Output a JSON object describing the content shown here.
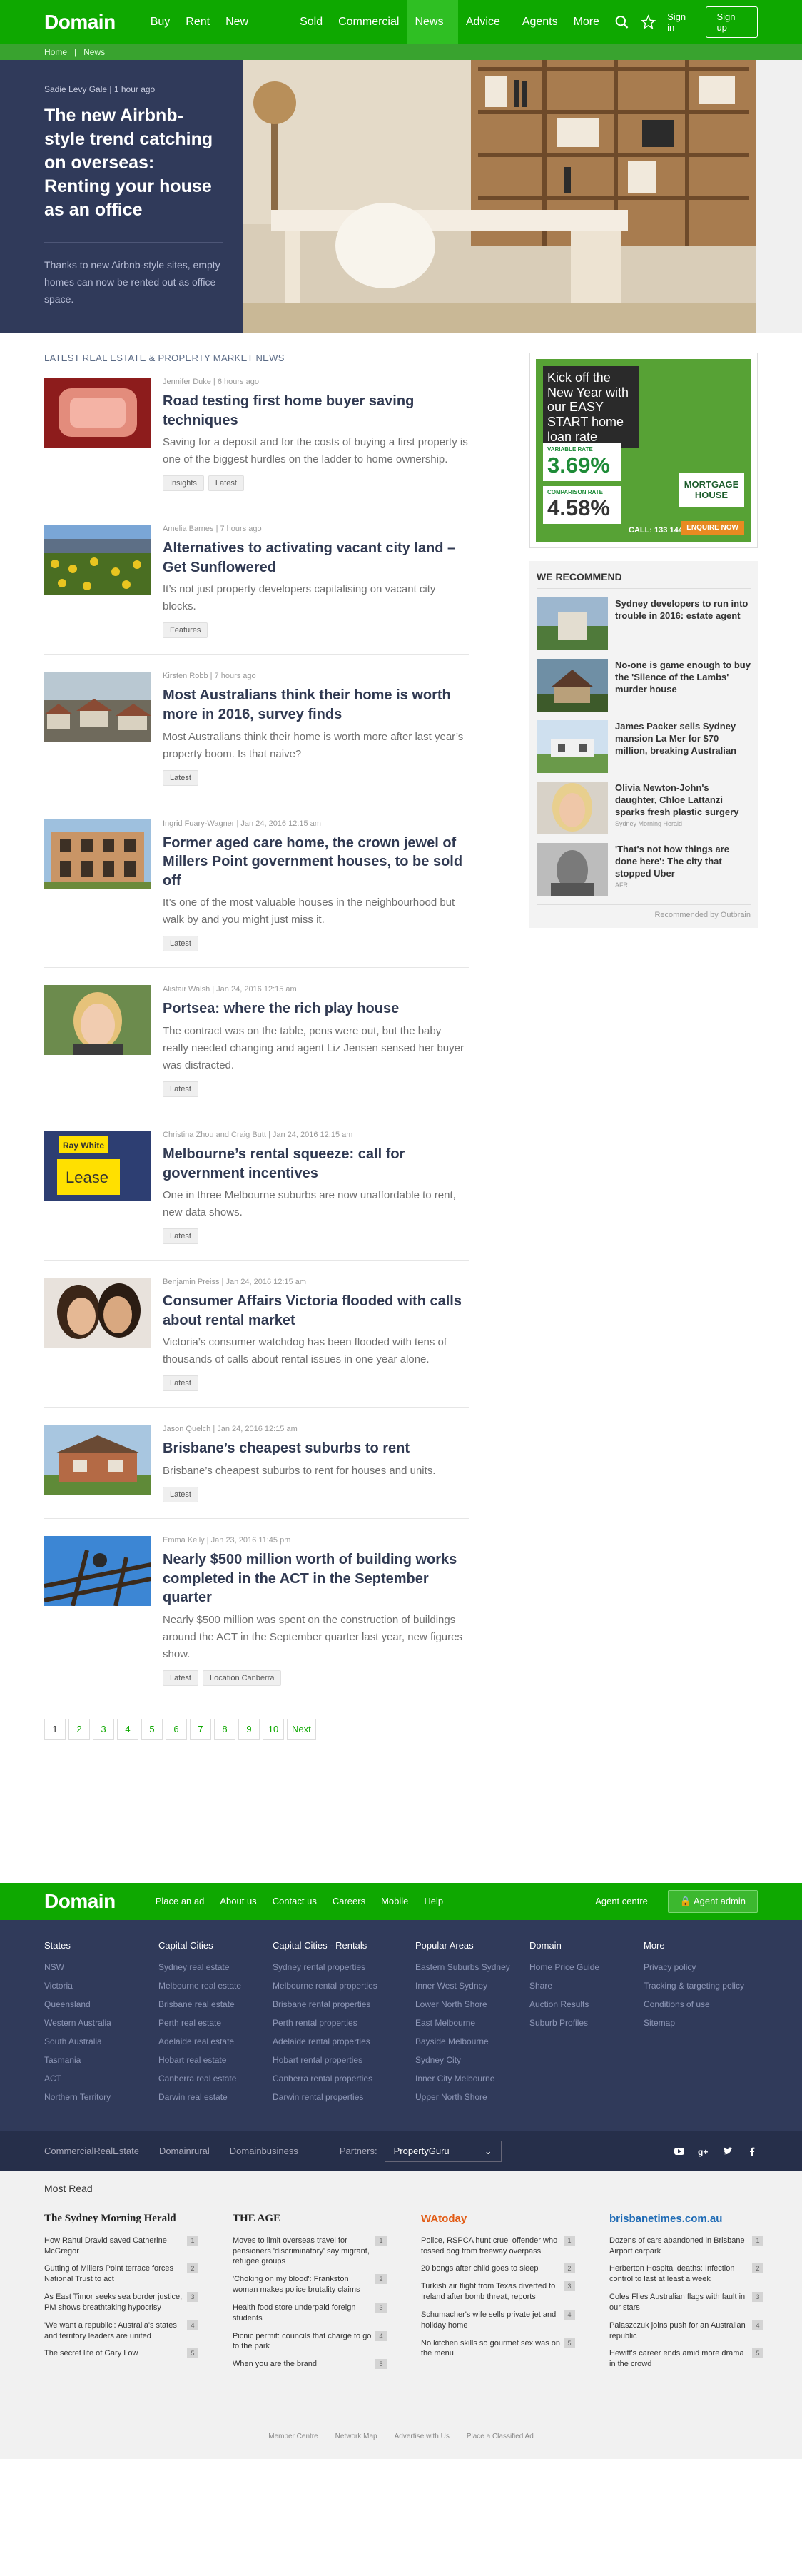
{
  "nav": {
    "logo": "Domain",
    "links": [
      "Buy",
      "Rent",
      "New Homes",
      "Sold",
      "Commercial",
      "News ▾",
      "Advice ▾",
      "Agents",
      "More ▾"
    ],
    "signin": "Sign in",
    "signup": "Sign up"
  },
  "breadcrumb": [
    "Home",
    "News"
  ],
  "hero": {
    "meta": "Sadie Levy Gale | 1 hour ago",
    "title": "The new Airbnb-style trend catching on overseas: Renting your house as an office",
    "summary": "Thanks to new Airbnb-style sites, empty homes can now be rented out as office space."
  },
  "section_title": "LATEST REAL ESTATE & PROPERTY MARKET NEWS",
  "articles": [
    {
      "meta": "Jennifer Duke | 6 hours ago",
      "title": "Road testing first home buyer saving techniques",
      "summary": "Saving for a deposit and for the costs of buying a first property is one of the biggest hurdles on the ladder to home ownership.",
      "tags": [
        "Insights",
        "Latest"
      ]
    },
    {
      "meta": "Amelia Barnes | 7 hours ago",
      "title": "Alternatives to activating vacant city land – Get Sunflowered",
      "summary": "It’s not just property developers capitalising on vacant city blocks.",
      "tags": [
        "Features"
      ]
    },
    {
      "meta": "Kirsten Robb | 7 hours ago",
      "title": "Most Australians think their home is worth more in 2016, survey finds",
      "summary": "Most Australians think their home is worth more after last year’s property boom. Is that naive?",
      "tags": [
        "Latest"
      ]
    },
    {
      "meta": "Ingrid Fuary-Wagner | Jan 24, 2016 12:15 am",
      "title": "Former aged care home, the crown jewel of Millers Point government houses, to be sold off",
      "summary": "It’s one of the most valuable houses in the neighbourhood but walk by and you might just miss it.",
      "tags": [
        "Latest"
      ]
    },
    {
      "meta": "Alistair Walsh | Jan 24, 2016 12:15 am",
      "title": "Portsea: where the rich play house",
      "summary": "The contract was on the table, pens were out, but the baby really needed changing and agent Liz Jensen sensed her buyer was distracted.",
      "tags": [
        "Latest"
      ]
    },
    {
      "meta": "Christina Zhou and Craig Butt | Jan 24, 2016 12:15 am",
      "title": "Melbourne’s rental squeeze: call for government incentives",
      "summary": "One in three Melbourne suburbs are now unaffordable to rent, new data shows.",
      "tags": [
        "Latest"
      ]
    },
    {
      "meta": "Benjamin Preiss | Jan 24, 2016 12:15 am",
      "title": "Consumer Affairs Victoria flooded with calls about rental market",
      "summary": "Victoria’s consumer watchdog has been flooded with tens of thousands of calls about rental issues in one year alone.",
      "tags": [
        "Latest"
      ]
    },
    {
      "meta": "Jason Quelch | Jan 24, 2016 12:15 am",
      "title": "Brisbane’s cheapest suburbs to rent",
      "summary": "Brisbane’s cheapest suburbs to rent for houses and units.",
      "tags": [
        "Latest"
      ]
    },
    {
      "meta": "Emma Kelly | Jan 23, 2016 11:45 pm",
      "title": "Nearly $500 million worth of building works completed in the ACT in the September quarter",
      "summary": "Nearly $500 million was spent on the construction of buildings around the ACT in the September quarter last year, new figures show.",
      "tags": [
        "Latest",
        "Location Canberra"
      ]
    }
  ],
  "pagination": [
    "1",
    "2",
    "3",
    "4",
    "5",
    "6",
    "7",
    "8",
    "9",
    "10",
    "Next"
  ],
  "ad": {
    "headline": "Kick off the New Year with our EASY START home loan rate",
    "variable_label": "VARIABLE RATE",
    "variable_rate": "3.69%",
    "comparison_label": "COMPARISON RATE",
    "comparison_rate": "4.58%",
    "brand": "MORTGAGE HOUSE",
    "call": "CALL: 133 144",
    "enquire": "ENQUIRE NOW"
  },
  "recommend": {
    "title": "WE RECOMMEND",
    "items": [
      {
        "title": "Sydney developers to run into trouble in 2016: estate agent",
        "source": ""
      },
      {
        "title": "No-one is game enough to buy the 'Silence of the Lambs' murder house",
        "source": ""
      },
      {
        "title": "James Packer sells Sydney mansion La Mer for $70 million, breaking Australian",
        "source": ""
      },
      {
        "title": "Olivia Newton-John's daughter, Chloe Lattanzi sparks fresh plastic surgery",
        "source": "Sydney Morning Herald"
      },
      {
        "title": "'That's not how things are done here': The city that stopped Uber",
        "source": "AFR"
      }
    ],
    "footer": "Recommended by Outbrain"
  },
  "footer": {
    "logo": "Domain",
    "links": [
      "Place an ad",
      "About us",
      "Contact us",
      "Careers",
      "Mobile",
      "Help"
    ],
    "agent_centre": "Agent centre",
    "agent_admin": "Agent admin"
  },
  "directory": [
    {
      "title": "States",
      "items": [
        "NSW",
        "Victoria",
        "Queensland",
        "Western Australia",
        "South Australia",
        "Tasmania",
        "ACT",
        "Northern Territory"
      ]
    },
    {
      "title": "Capital Cities",
      "items": [
        "Sydney real estate",
        "Melbourne real estate",
        "Brisbane real estate",
        "Perth real estate",
        "Adelaide real estate",
        "Hobart real estate",
        "Canberra real estate",
        "Darwin real estate"
      ]
    },
    {
      "title": "Capital Cities - Rentals",
      "items": [
        "Sydney rental properties",
        "Melbourne rental properties",
        "Brisbane rental properties",
        "Perth rental properties",
        "Adelaide rental properties",
        "Hobart rental properties",
        "Canberra rental properties",
        "Darwin rental properties"
      ]
    },
    {
      "title": "Popular Areas",
      "items": [
        "Eastern Suburbs Sydney",
        "Inner West Sydney",
        "Lower North Shore",
        "East Melbourne",
        "Bayside Melbourne",
        "Sydney City",
        "Inner City Melbourne",
        "Upper North Shore"
      ]
    },
    {
      "title": "Domain",
      "items": [
        "Home Price Guide",
        "Share",
        "Auction Results",
        "Suburb Profiles"
      ]
    },
    {
      "title": "More",
      "items": [
        "Privacy policy",
        "Tracking & targeting policy",
        "Conditions of use",
        "Sitemap"
      ]
    }
  ],
  "brands": [
    "CommercialRealEstate",
    "Domainrural",
    "Domainbusiness"
  ],
  "partners_label": "Partners:",
  "partner_selected": "PropertyGuru",
  "mostread": {
    "title": "Most Read",
    "columns": [
      {
        "logo": "The Sydney Morning Herald",
        "items": [
          {
            "t": "How Rahul Dravid saved Catherine McGregor",
            "n": "1"
          },
          {
            "t": "Gutting of Millers Point terrace forces National Trust to act",
            "n": "2"
          },
          {
            "t": "As East Timor seeks sea border justice, PM shows breathtaking hypocrisy",
            "n": "3"
          },
          {
            "t": "'We want a republic': Australia's states and territory leaders are united",
            "n": "4"
          },
          {
            "t": "The secret life of Gary Low",
            "n": "5"
          }
        ]
      },
      {
        "logo": "THE AGE",
        "items": [
          {
            "t": "Moves to limit overseas travel for pensioners 'discriminatory' say migrant, refugee groups",
            "n": "1"
          },
          {
            "t": "'Choking on my blood': Frankston woman makes police brutality claims",
            "n": "2"
          },
          {
            "t": "Health food store underpaid foreign students",
            "n": "3"
          },
          {
            "t": "Picnic permit: councils that charge to go to the park",
            "n": "4"
          },
          {
            "t": "When you are the brand",
            "n": "5"
          }
        ]
      },
      {
        "logo": "WAtoday",
        "items": [
          {
            "t": "Police, RSPCA hunt cruel offender who tossed dog from freeway overpass",
            "n": "1"
          },
          {
            "t": "20 bongs after child goes to sleep",
            "n": "2"
          },
          {
            "t": "Turkish air flight from Texas diverted to Ireland after bomb threat, reports",
            "n": "3"
          },
          {
            "t": "Schumacher's wife sells private jet and holiday home",
            "n": "4"
          },
          {
            "t": "No kitchen skills so gourmet sex was on the menu",
            "n": "5"
          }
        ]
      },
      {
        "logo": "brisbanetimes.com.au",
        "items": [
          {
            "t": "Dozens of cars abandoned in Brisbane Airport carpark",
            "n": "1"
          },
          {
            "t": "Herberton Hospital deaths: Infection control to last at least a week",
            "n": "2"
          },
          {
            "t": "Coles Flies Australian flags with fault in our stars",
            "n": "3"
          },
          {
            "t": "Palaszczuk joins push for an Australian republic",
            "n": "4"
          },
          {
            "t": "Hewitt's career ends amid more drama in the crowd",
            "n": "5"
          }
        ]
      }
    ]
  },
  "bottom_links": [
    "Member Centre",
    "Network Map",
    "Advertise with Us",
    "Place a Classified Ad"
  ]
}
